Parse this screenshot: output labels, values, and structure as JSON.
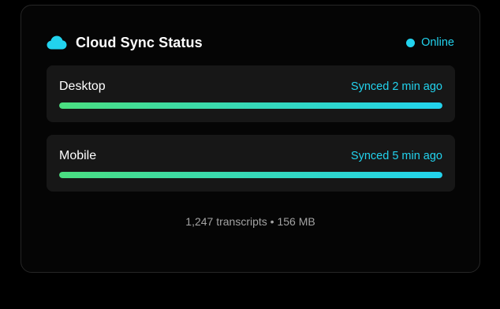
{
  "header": {
    "icon": "cloud-icon",
    "title": "Cloud Sync Status",
    "status": {
      "label": "Online",
      "color": "#22d3ee"
    }
  },
  "devices": [
    {
      "name": "Desktop",
      "sync_text": "Synced 2 min ago",
      "progress": 1.0
    },
    {
      "name": "Mobile",
      "sync_text": "Synced 5 min ago",
      "progress": 1.0
    }
  ],
  "footer": {
    "summary": "1,247 transcripts • 156 MB"
  },
  "colors": {
    "accent": "#22d3ee",
    "progress_start": "#4ade80",
    "progress_end": "#22d3ee",
    "card_background": "#050505",
    "device_background": "#171717"
  }
}
